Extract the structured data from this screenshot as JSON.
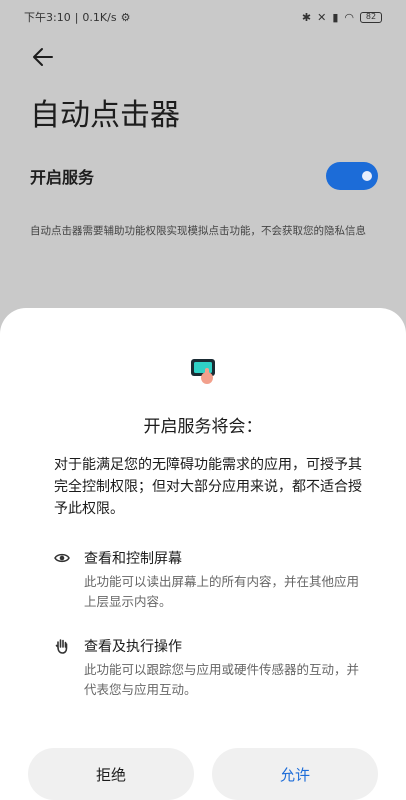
{
  "status_bar": {
    "time": "下午3:10",
    "speed": "0.1K/s",
    "battery": "82"
  },
  "page": {
    "title": "自动点击器",
    "service_label": "开启服务",
    "toggle_on": true,
    "description": "自动点击器需要辅助功能权限实现模拟点击功能，不会获取您的隐私信息"
  },
  "sheet": {
    "title": "开启服务将会：",
    "body": "对于能满足您的无障碍功能需求的应用，可授予其完全控制权限；但对大部分应用来说，都不适合授予此权限。",
    "permissions": [
      {
        "icon": "eye-icon",
        "title": "查看和控制屏幕",
        "desc": "此功能可以读出屏幕上的所有内容，并在其他应用上层显示内容。"
      },
      {
        "icon": "hand-icon",
        "title": "查看及执行操作",
        "desc": "此功能可以跟踪您与应用或硬件传感器的互动，并代表您与应用互动。"
      }
    ],
    "deny_label": "拒绝",
    "allow_label": "允许"
  },
  "colors": {
    "accent": "#1c6cd8",
    "dim_background": "#c9c9c9"
  }
}
